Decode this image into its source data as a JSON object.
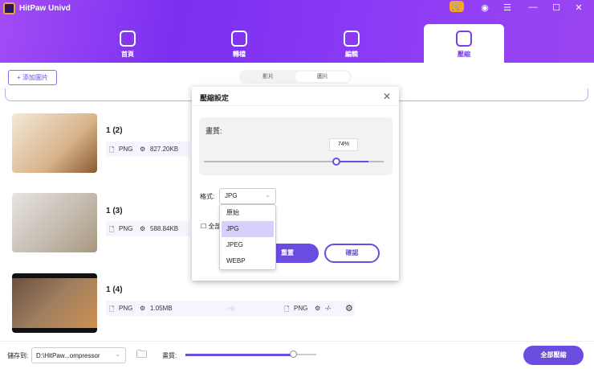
{
  "app": {
    "title": "HitPaw Univd"
  },
  "tabs": [
    {
      "label": "首頁",
      "icon": "home-icon"
    },
    {
      "label": "轉檔",
      "icon": "convert-icon"
    },
    {
      "label": "編輯",
      "icon": "edit-icon"
    },
    {
      "label": "壓縮",
      "icon": "compress-icon",
      "active": true
    }
  ],
  "toolbar": {
    "add_label": "+ 添加圖片",
    "segments": [
      "影片",
      "圖片"
    ],
    "active_segment": "圖片"
  },
  "files": [
    {
      "name": "1 (2)",
      "format": "PNG",
      "size": "827.20KB"
    },
    {
      "name": "1 (3)",
      "format": "PNG",
      "size": "588.84KB"
    },
    {
      "name": "1 (4)",
      "format": "PNG",
      "size": "1.05MB",
      "out_format": "PNG",
      "out_size": "-/-"
    }
  ],
  "dialog": {
    "title": "壓縮設定",
    "quality_label": "畫質:",
    "quality_value": "74%",
    "quality_percent": 74,
    "format_label": "格式:",
    "format_value": "JPG",
    "format_options": [
      "原始",
      "JPG",
      "JPEG",
      "WEBP"
    ],
    "apply_all_label": "全部",
    "reset_label": "重置",
    "confirm_label": "確認"
  },
  "bottom": {
    "save_label": "儲存到:",
    "path": "D:\\HitPaw...ompressor",
    "quality_label": "畫質:",
    "quality_percent": 80,
    "compress_all_label": "全部壓縮"
  },
  "colors": {
    "accent": "#6a4ce0",
    "header": "#7b2ff0"
  }
}
